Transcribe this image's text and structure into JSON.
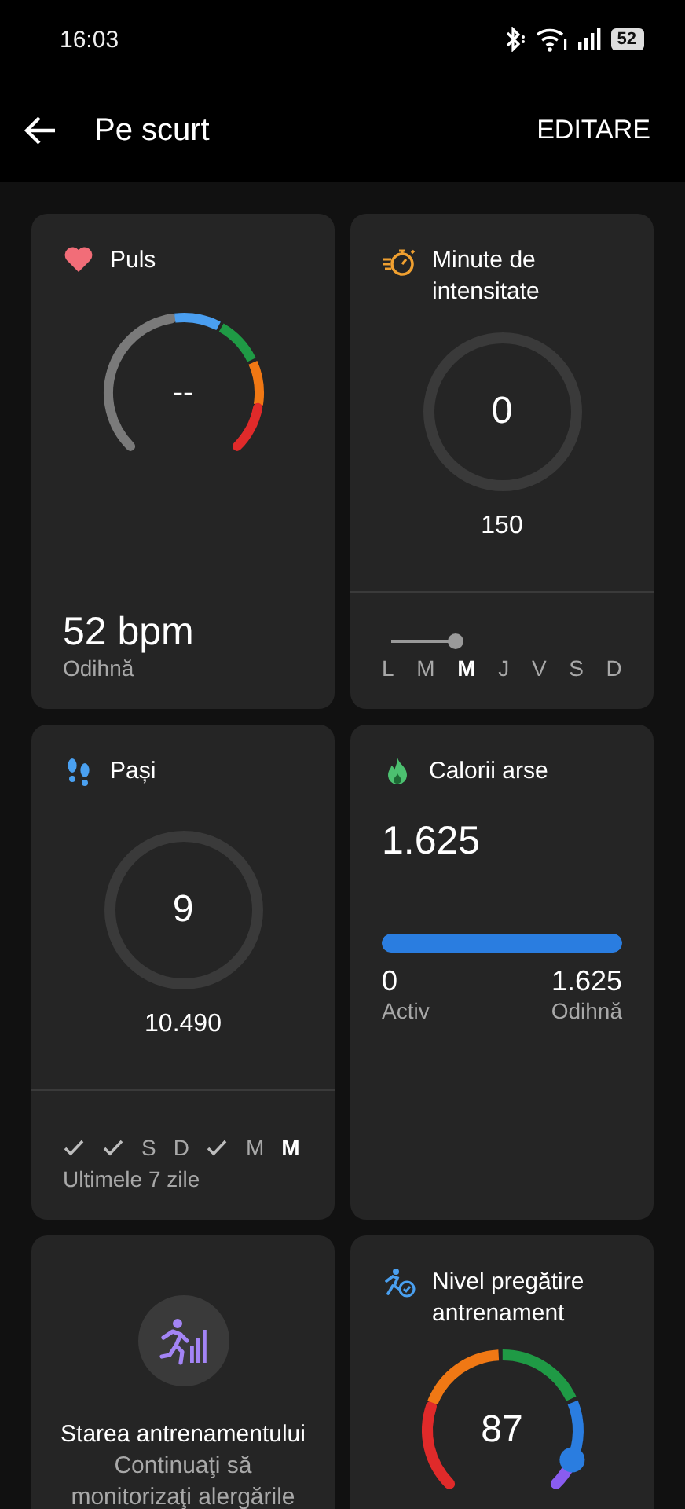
{
  "status_bar": {
    "time": "16:03",
    "battery": "52"
  },
  "header": {
    "title": "Pe scurt",
    "action": "EDITARE"
  },
  "heart": {
    "title": "Puls",
    "value": "--",
    "reading": "52 bpm",
    "caption": "Odihnă",
    "zones": [
      {
        "color": "#7a7a7a"
      },
      {
        "color": "#4a9ef0"
      },
      {
        "color": "#1f9a45"
      },
      {
        "color": "#f07814"
      },
      {
        "color": "#e02a2a"
      }
    ]
  },
  "intensity": {
    "title": "Minute de intensitate",
    "value": "0",
    "goal": "150",
    "days": [
      {
        "label": "L",
        "selected": false
      },
      {
        "label": "M",
        "selected": false
      },
      {
        "label": "M",
        "selected": true
      },
      {
        "label": "J",
        "selected": false
      },
      {
        "label": "V",
        "selected": false
      },
      {
        "label": "S",
        "selected": false
      },
      {
        "label": "D",
        "selected": false
      }
    ]
  },
  "steps": {
    "title": "Pași",
    "value": "9",
    "goal": "10.490",
    "caption": "Ultimele 7 zile",
    "days": [
      {
        "kind": "check",
        "selected": false
      },
      {
        "kind": "check",
        "selected": false
      },
      {
        "kind": "letter",
        "label": "S",
        "selected": false
      },
      {
        "kind": "letter",
        "label": "D",
        "selected": false
      },
      {
        "kind": "check",
        "selected": false
      },
      {
        "kind": "letter",
        "label": "M",
        "selected": false
      },
      {
        "kind": "letter",
        "label": "M",
        "selected": true
      }
    ]
  },
  "calories": {
    "title": "Calorii arse",
    "total": "1.625",
    "level": 1,
    "active_value": "0",
    "active_label": "Activ",
    "rest_value": "1.625",
    "rest_label": "Odihnă"
  },
  "training_status": {
    "title": "Starea antrenamentului",
    "text": "Continuaţi să monitorizaţi alergările"
  },
  "readiness": {
    "title": "Nivel pregătire antrenament",
    "value": "87",
    "zones": [
      {
        "color": "#e02a2a"
      },
      {
        "color": "#f07814"
      },
      {
        "color": "#1f9a45"
      },
      {
        "color": "#2a7de0"
      },
      {
        "color": "#8a5cf0"
      }
    ]
  }
}
